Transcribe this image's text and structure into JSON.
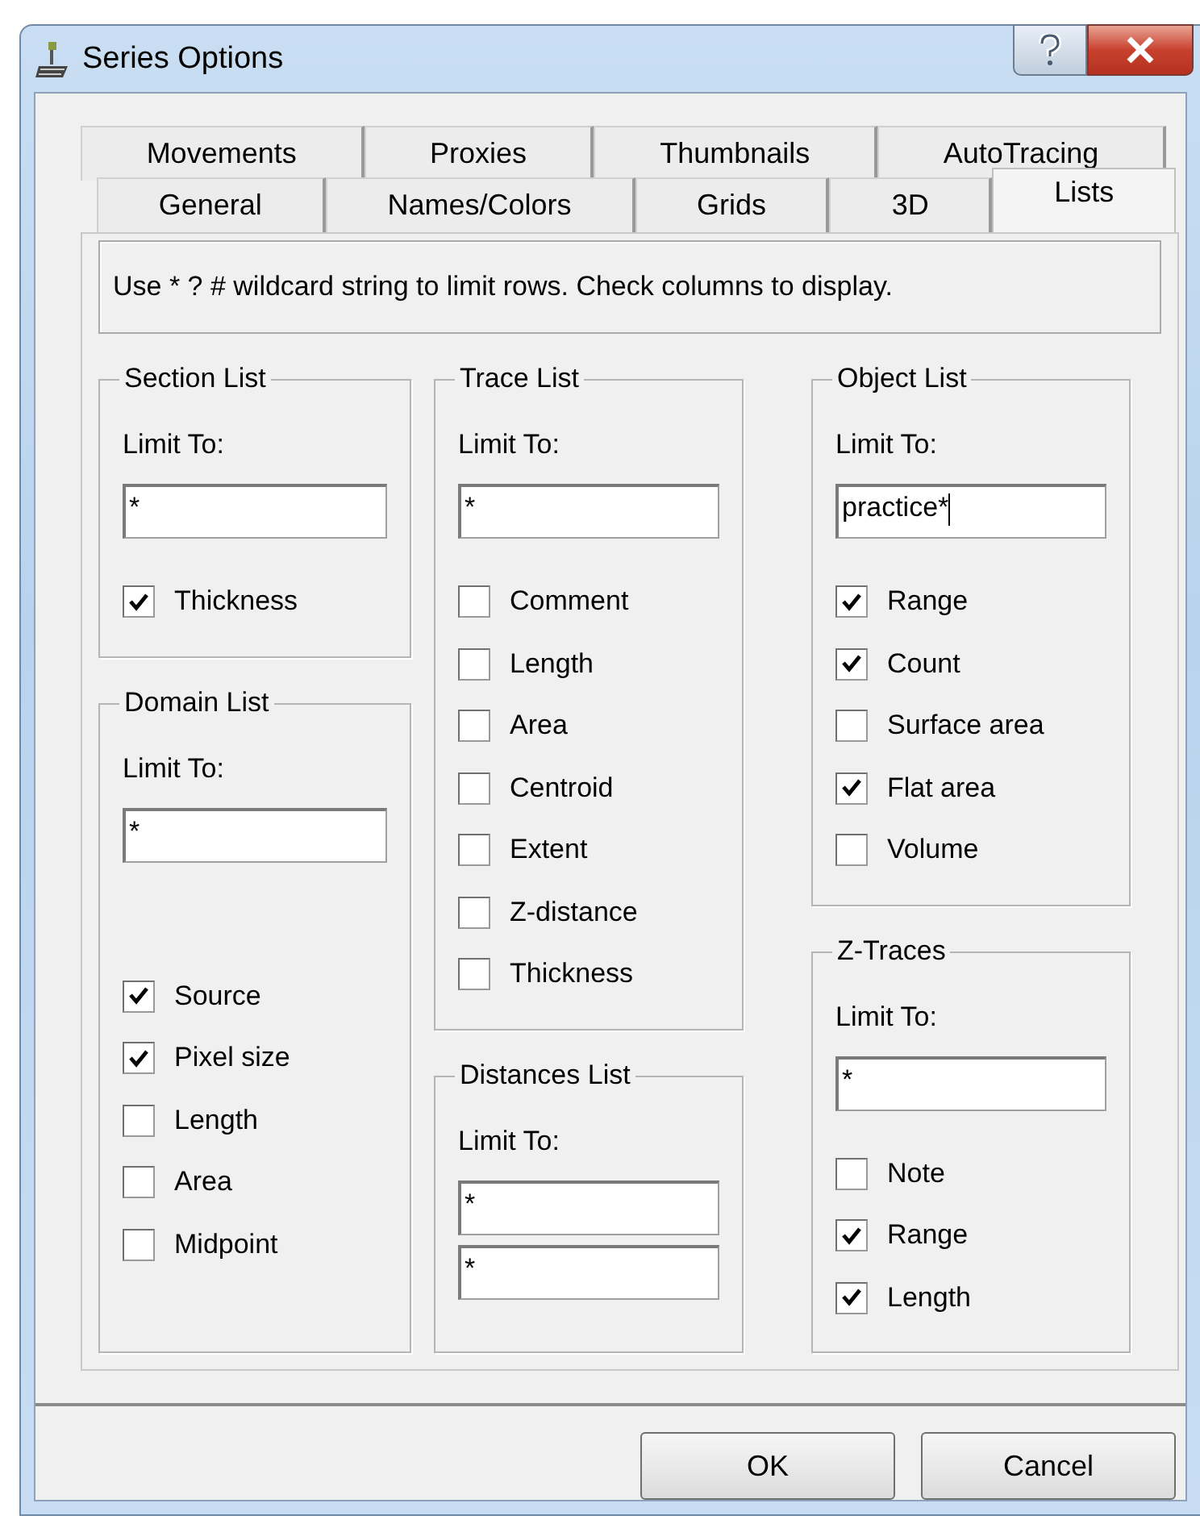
{
  "window": {
    "title": "Series Options"
  },
  "tab_rows": [
    {
      "tabs": [
        {
          "label": "Movements",
          "selected": false
        },
        {
          "label": "Proxies",
          "selected": false
        },
        {
          "label": "Thumbnails",
          "selected": false
        },
        {
          "label": "AutoTracing",
          "selected": false
        }
      ]
    },
    {
      "tabs": [
        {
          "label": "General",
          "selected": false
        },
        {
          "label": "Names/Colors",
          "selected": false
        },
        {
          "label": "Grids",
          "selected": false
        },
        {
          "label": "3D",
          "selected": false
        },
        {
          "label": "Lists",
          "selected": true
        }
      ]
    }
  ],
  "info": "Use * ? # wildcard string to limit rows. Check columns to display.",
  "columns": [
    {
      "groups": [
        {
          "title": "Section List",
          "limit_label": "Limit To:",
          "fields": [
            {
              "value": "*",
              "focused": false
            }
          ],
          "checks": [
            {
              "label": "Thickness",
              "checked": true
            }
          ]
        },
        {
          "title": "Domain List",
          "limit_label": "Limit To:",
          "fields": [
            {
              "value": "*",
              "focused": false
            }
          ],
          "checks": [
            {
              "label": "Source",
              "checked": true
            },
            {
              "label": "Pixel size",
              "checked": true
            },
            {
              "label": "Length",
              "checked": false
            },
            {
              "label": "Area",
              "checked": false
            },
            {
              "label": "Midpoint",
              "checked": false
            }
          ]
        }
      ]
    },
    {
      "groups": [
        {
          "title": "Trace List",
          "limit_label": "Limit To:",
          "fields": [
            {
              "value": "*",
              "focused": false
            }
          ],
          "checks": [
            {
              "label": "Comment",
              "checked": false
            },
            {
              "label": "Length",
              "checked": false
            },
            {
              "label": "Area",
              "checked": false
            },
            {
              "label": "Centroid",
              "checked": false
            },
            {
              "label": "Extent",
              "checked": false
            },
            {
              "label": "Z-distance",
              "checked": false
            },
            {
              "label": "Thickness",
              "checked": false
            }
          ]
        },
        {
          "title": "Distances List",
          "limit_label": "Limit To:",
          "fields": [
            {
              "value": "*",
              "focused": false
            },
            {
              "value": "*",
              "focused": false
            }
          ]
        }
      ]
    },
    {
      "groups": [
        {
          "title": "Object List",
          "limit_label": "Limit To:",
          "fields": [
            {
              "value": "practice*",
              "focused": true
            }
          ],
          "checks": [
            {
              "label": "Range",
              "checked": true
            },
            {
              "label": "Count",
              "checked": true
            },
            {
              "label": "Surface area",
              "checked": false
            },
            {
              "label": "Flat area",
              "checked": true
            },
            {
              "label": "Volume",
              "checked": false
            }
          ]
        },
        {
          "title": "Z-Traces",
          "limit_label": "Limit To:",
          "fields": [
            {
              "value": "*",
              "focused": false
            }
          ],
          "checks": [
            {
              "label": "Note",
              "checked": false
            },
            {
              "label": "Range",
              "checked": true
            },
            {
              "label": "Length",
              "checked": true
            }
          ]
        }
      ]
    }
  ],
  "buttons": [
    {
      "label": "OK"
    },
    {
      "label": "Cancel"
    }
  ]
}
